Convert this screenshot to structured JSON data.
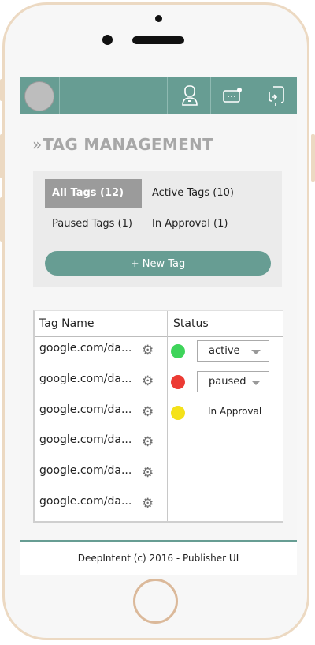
{
  "page": {
    "title": "TAG MANAGEMENT",
    "title_icon": "double-chevron-right-icon"
  },
  "topbar": {
    "background": "#679d93",
    "icons": [
      "user-icon",
      "message-icon",
      "logout-icon"
    ]
  },
  "filters": {
    "all": {
      "label": "All Tags",
      "count": "(12)"
    },
    "active": {
      "label": "Active Tags",
      "count": "(10)"
    },
    "paused": {
      "label": "Paused Tags",
      "count": "(1)"
    },
    "approval": {
      "label": "In Approval",
      "count": "(1)"
    },
    "selected": "all"
  },
  "new_tag_button": {
    "label": "+ New Tag"
  },
  "table": {
    "headers": {
      "name": "Tag Name",
      "status": "Status"
    },
    "rows": [
      {
        "name": "google.com/da...",
        "status_type": "select",
        "status": "active",
        "dot": "#3ed45a"
      },
      {
        "name": "google.com/da...",
        "status_type": "select",
        "status": "paused",
        "dot": "#ec3b34"
      },
      {
        "name": "google.com/da...",
        "status_type": "text",
        "status": "In Approval",
        "dot": "#f5e21a"
      },
      {
        "name": "google.com/da...",
        "status_type": "none",
        "status": ""
      },
      {
        "name": "google.com/da...",
        "status_type": "none",
        "status": ""
      },
      {
        "name": "google.com/da...",
        "status_type": "none",
        "status": ""
      }
    ],
    "row_action_icon": "gear-icon"
  },
  "footer": {
    "text": "DeepIntent (c) 2016 - Publisher UI"
  },
  "colors": {
    "accent": "#679d93",
    "panel": "#ebebeb",
    "title": "#a7a7a7"
  }
}
